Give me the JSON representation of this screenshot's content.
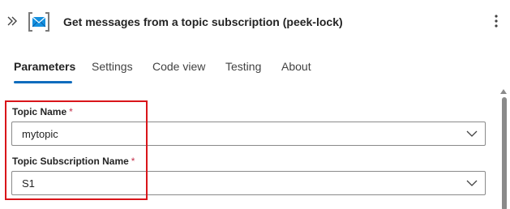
{
  "header": {
    "title": "Get messages from a topic subscription (peek-lock)",
    "icons": {
      "collapse": "double-chevron-right-icon",
      "service": "service-bus-envelope-icon",
      "more": "more-vertical-icon"
    }
  },
  "tabs": [
    {
      "label": "Parameters",
      "active": true
    },
    {
      "label": "Settings",
      "active": false
    },
    {
      "label": "Code view",
      "active": false
    },
    {
      "label": "Testing",
      "active": false
    },
    {
      "label": "About",
      "active": false
    }
  ],
  "fields": [
    {
      "label": "Topic Name",
      "required_mark": "*",
      "value": "mytopic"
    },
    {
      "label": "Topic Subscription Name",
      "required_mark": "*",
      "value": "S1"
    }
  ],
  "colors": {
    "accent": "#0f6cbd",
    "highlight": "#d9151a",
    "required": "#c4314b"
  }
}
